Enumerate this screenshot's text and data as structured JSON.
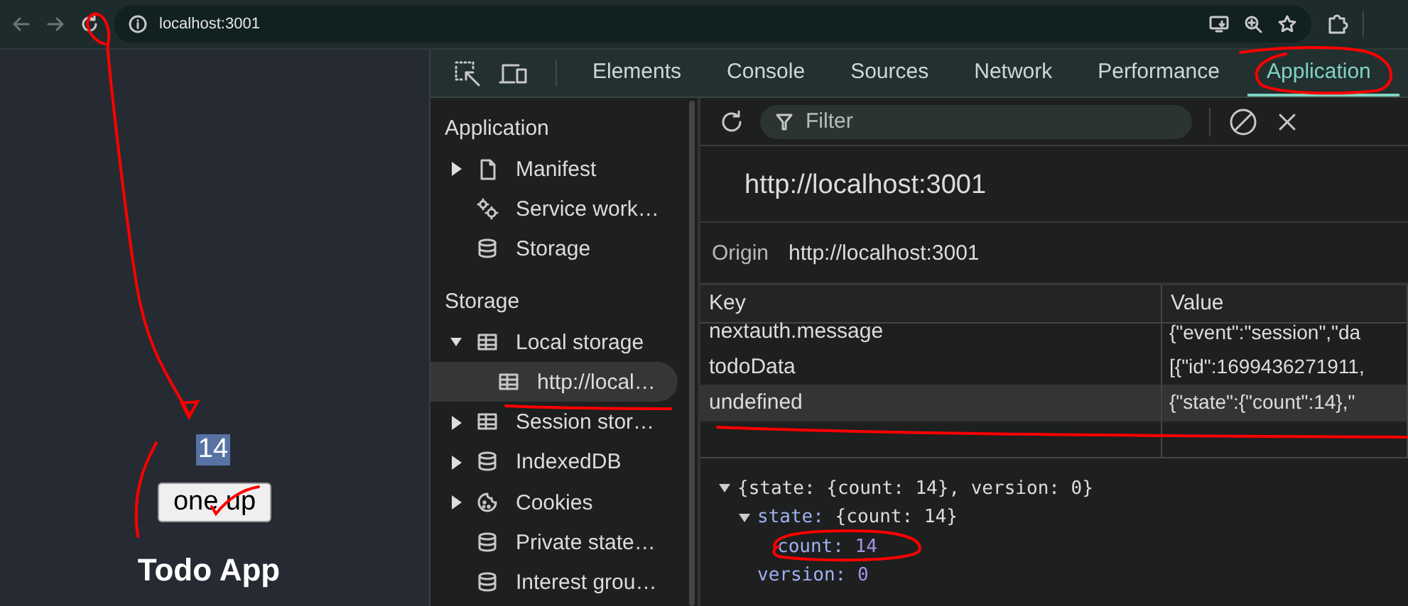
{
  "browser": {
    "url": "localhost:3001"
  },
  "page": {
    "counter": {
      "text": "14",
      "selected": true
    },
    "button": "one up",
    "heading": "Todo App"
  },
  "devtools": {
    "tabs": [
      {
        "label": "Elements",
        "selected": false
      },
      {
        "label": "Console",
        "selected": false
      },
      {
        "label": "Sources",
        "selected": false
      },
      {
        "label": "Network",
        "selected": false
      },
      {
        "label": "Performance",
        "selected": false
      },
      {
        "label": "Application",
        "selected": true
      }
    ],
    "sidebar": [
      {
        "title": "Application",
        "items": [
          {
            "label": "Manifest",
            "expanded": false,
            "selected": false
          },
          {
            "label": "Service work…",
            "selected": false
          },
          {
            "label": "Storage",
            "selected": false
          }
        ]
      },
      {
        "title": "Storage",
        "items": [
          {
            "label": "Local storage",
            "expanded": true,
            "selected": false,
            "children": [
              {
                "label": "http://local…",
                "selected": true
              }
            ]
          },
          {
            "label": "Session stor…",
            "expanded": false,
            "selected": false
          },
          {
            "label": "IndexedDB",
            "expanded": false,
            "selected": false
          },
          {
            "label": "Cookies",
            "expanded": false,
            "selected": false
          },
          {
            "label": "Private state…",
            "selected": false
          },
          {
            "label": "Interest grou…",
            "selected": false
          }
        ]
      }
    ],
    "filter": {
      "placeholder": "Filter"
    },
    "origin": {
      "title": "http://localhost:3001",
      "label": "Origin",
      "value": "http://localhost:3001"
    },
    "table": {
      "columns": [
        "Key",
        "Value"
      ],
      "rows": [
        {
          "key": "nextauth.message",
          "value": "{\"event\":\"session\",\"da",
          "selected": false
        },
        {
          "key": "todoData",
          "value": "[{\"id\":1699436271911,",
          "selected": false
        },
        {
          "key": "undefined",
          "value": "{\"state\":{\"count\":14},\"",
          "selected": true
        }
      ]
    },
    "preview": {
      "text": "{state: {count: 14}, version: 0}",
      "expanded": true,
      "children": [
        {
          "key": "state:",
          "value": "{count: 14}",
          "expanded": true,
          "children": [
            {
              "key": "count:",
              "value": "14"
            }
          ]
        },
        {
          "key": "version:",
          "value": "0"
        }
      ]
    }
  }
}
